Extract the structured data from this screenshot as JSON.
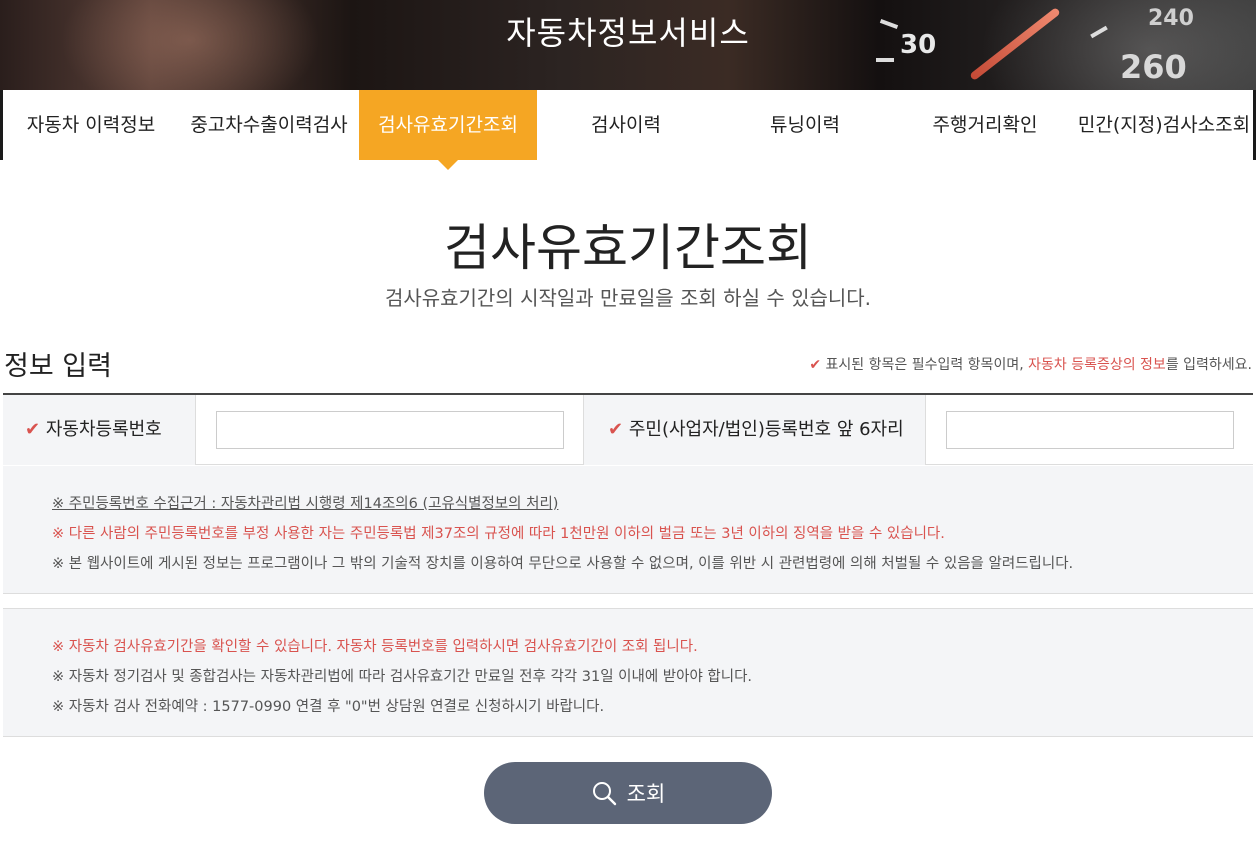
{
  "header": {
    "title": "자동차정보서비스",
    "gauge_labels": [
      "30",
      "240",
      "260"
    ]
  },
  "nav": {
    "items": [
      {
        "label": "자동차 이력정보"
      },
      {
        "label": "중고차수출이력검사"
      },
      {
        "label": "검사유효기간조회",
        "active": true
      },
      {
        "label": "검사이력"
      },
      {
        "label": "튜닝이력"
      },
      {
        "label": "주행거리확인"
      },
      {
        "label": "민간(지정)검사소조회"
      }
    ]
  },
  "page": {
    "title": "검사유효기간조회",
    "subtitle": "검사유효기간의 시작일과 만료일을 조회 하실 수 있습니다."
  },
  "section": {
    "title": "정보 입력",
    "note_pre": "표시된 항목은 필수입력 항목이며, ",
    "note_highlight": "자동차 등록증상의 정보",
    "note_post": "를 입력하세요."
  },
  "form": {
    "vehicle_label": "자동차등록번호",
    "vehicle_value": "",
    "id_label": "주민(사업자/법인)등록번호 앞 6자리",
    "id_value": ""
  },
  "notices1": [
    "※ 주민등록번호 수집근거 : 자동차관리법 시행령 제14조의6 (고유식별정보의 처리)",
    "※ 다른 사람의 주민등록번호를 부정 사용한 자는 주민등록법 제37조의 규정에 따라 1천만원 이하의 벌금 또는 3년 이하의 징역을 받을 수 있습니다.",
    "※ 본 웹사이트에 게시된 정보는 프로그램이나 그 밖의 기술적 장치를 이용하여 무단으로 사용할 수 없으며, 이를 위반 시 관련법령에 의해 처벌될 수 있음을 알려드립니다."
  ],
  "notices2": [
    "※ 자동차 검사유효기간을 확인할 수 있습니다. 자동차 등록번호를 입력하시면 검사유효기간이 조회 됩니다.",
    "※ 자동차 정기검사 및 종합검사는 자동차관리법에 따라 검사유효기간 만료일 전후 각각 31일 이내에 받아야 합니다.",
    "※ 자동차 검사 전화예약 : 1577-0990 연결 후 \"0\"번 상담원 연결로 신청하시기 바랍니다."
  ],
  "search_button": {
    "label": "조회",
    "icon": "search-icon"
  },
  "colors": {
    "accent": "#f5a623",
    "warning": "#d9534f",
    "button": "#5c6577"
  }
}
